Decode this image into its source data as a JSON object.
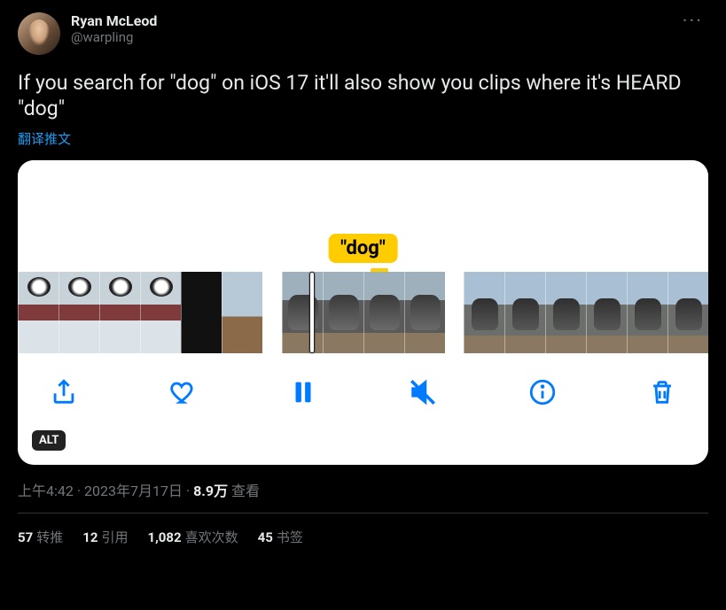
{
  "user": {
    "display_name": "Ryan McLeod",
    "handle": "@warpling"
  },
  "body": "If you search for \"dog\" on iOS 17 it'll also show you clips where it's HEARD \"dog\"",
  "translate_label": "翻译推文",
  "media": {
    "caption_label": "\"dog\"",
    "alt_badge": "ALT",
    "controls": {
      "share": "share",
      "like": "like",
      "pause": "pause",
      "mute": "mute",
      "info": "info",
      "trash": "trash"
    }
  },
  "meta": {
    "time": "上午4:42",
    "date": "2023年7月17日",
    "views_count": "8.9万",
    "views_label": "查看"
  },
  "stats": {
    "retweets": {
      "count": "57",
      "label": "转推"
    },
    "quotes": {
      "count": "12",
      "label": "引用"
    },
    "likes": {
      "count": "1,082",
      "label": "喜欢次数"
    },
    "bookmarks": {
      "count": "45",
      "label": "书签"
    }
  }
}
